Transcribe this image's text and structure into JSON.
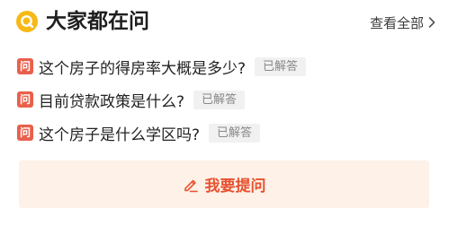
{
  "colors": {
    "logo": "#f7b916",
    "question_badge": "#e8604c",
    "status_bg": "#f1f1f1",
    "status_text": "#888888",
    "ask_bg": "#fdf1e8",
    "ask_text": "#e7512f"
  },
  "header": {
    "logo_icon": "q-logo-icon",
    "title": "大家都在问",
    "view_all_label": "查看全部",
    "view_all_icon": "chevron-right-icon"
  },
  "questions": [
    {
      "badge": "问",
      "text": "这个房子的得房率大概是多少?",
      "status": "已解答"
    },
    {
      "badge": "问",
      "text": "目前贷款政策是什么?",
      "status": "已解答"
    },
    {
      "badge": "问",
      "text": "这个房子是什么学区吗?",
      "status": "已解答"
    }
  ],
  "ask_button": {
    "icon": "pencil-icon",
    "label": "我要提问"
  }
}
